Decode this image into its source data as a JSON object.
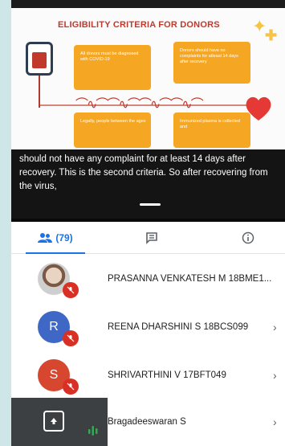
{
  "slide": {
    "title": "ELIGIBILITY CRITERIA FOR DONORS",
    "box1": "All donors must be diagnosed with COVID-19",
    "box2": "Donors should have no complaints for atleast 14 days after recovery",
    "box3": "Legally, people between the ages",
    "box4": "Immunized plasma is collected and"
  },
  "caption": {
    "text": "should not have any complaint for at least 14 days after recovery. This is the second criteria. So after recovering from the virus,"
  },
  "tabs": {
    "people_count": "(79)"
  },
  "participants": [
    {
      "name": "PRASANNA VENKATESH M 18BME1...",
      "avatar_type": "photo"
    },
    {
      "name": "REENA DHARSHINI S 18BCS099",
      "initial": "R"
    },
    {
      "name": "SHRIVARTHINI V 17BFT049",
      "initial": "S"
    },
    {
      "name": "Bragadeeswaran S"
    }
  ],
  "icons": {
    "people": "people-icon",
    "chat": "chat-icon",
    "info": "info-icon",
    "mute": "mic-off-icon",
    "chevron": "chevron-right-icon",
    "present": "present-screen-icon"
  },
  "colors": {
    "accent": "#1a73e8",
    "mute_red": "#d93025",
    "slide_box": "#f5a623",
    "slide_title": "#c0392b"
  }
}
